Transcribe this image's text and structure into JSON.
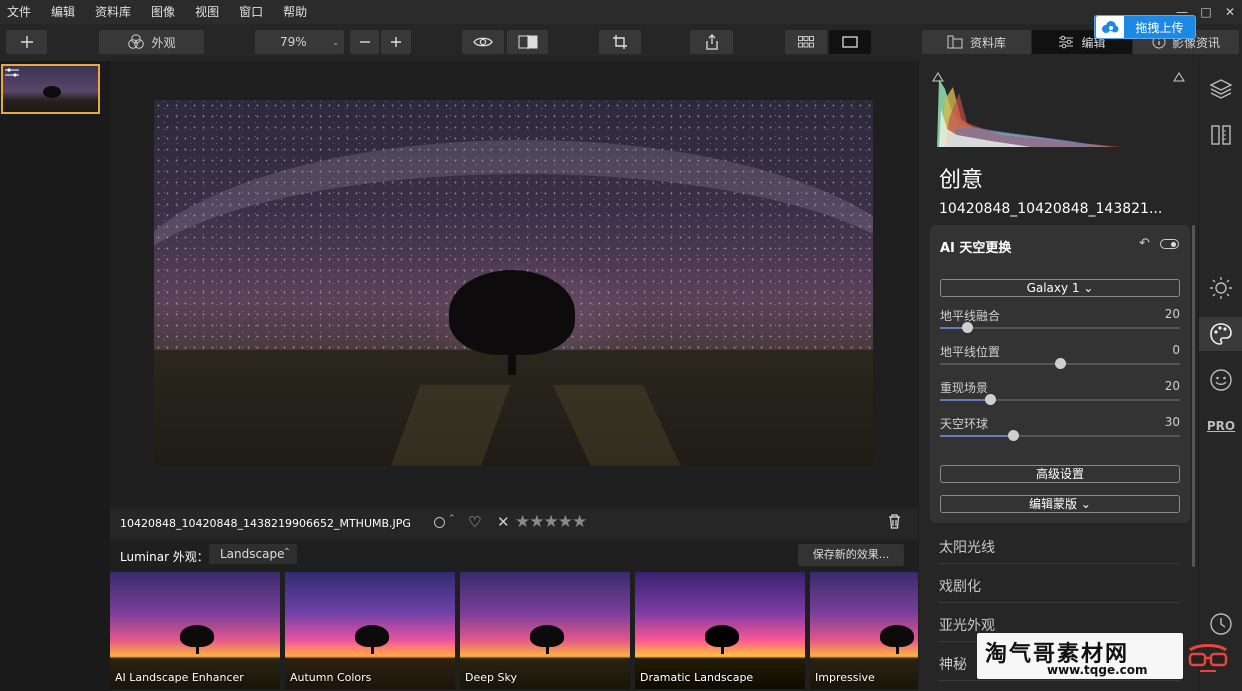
{
  "menu": [
    "文件",
    "编辑",
    "资料库",
    "图像",
    "视图",
    "窗口",
    "帮助"
  ],
  "window_controls": [
    "—",
    "□",
    "✕"
  ],
  "upload": {
    "label": "拖拽上传"
  },
  "toolbar": {
    "looks_label": "外观",
    "zoom": "79%",
    "library_tab": "资料库",
    "edit_tab": "编辑",
    "info_tab": "影像资讯"
  },
  "filename": "10420848_10420848_1438219906652_MTHUMB.JPG",
  "looks": {
    "label": "Luminar 外观：",
    "category": "Landscape",
    "save_label": "保存新的效果...",
    "presets": [
      "AI Landscape Enhancer",
      "Autumn Colors",
      "Deep Sky",
      "Dramatic Landscape",
      "Impressive"
    ]
  },
  "panel": {
    "title": "创意",
    "subtitle": "10420848_10420848_143821...",
    "tool": {
      "name": "AI 天空更换",
      "sky_choice": "Galaxy 1",
      "sliders": [
        {
          "label": "地平线融合",
          "value": 20
        },
        {
          "label": "地平线位置",
          "value": 0
        },
        {
          "label": "重现场景",
          "value": 20
        },
        {
          "label": "天空环球",
          "value": 30
        }
      ],
      "advanced": "高级设置",
      "edit_mask": "编辑蒙版"
    },
    "sections": [
      "太阳光线",
      "戏剧化",
      "亚光外观",
      "神秘"
    ]
  },
  "rail": {
    "pro": "PRO",
    "active": "creative-palette-icon"
  },
  "watermark": {
    "line1": "淘气哥素材网",
    "line2": "www.tqge.com"
  },
  "colors": {
    "accent": "#e9a93c",
    "upload": "#1e88e5",
    "slider_fill": "#6a7ab4"
  }
}
